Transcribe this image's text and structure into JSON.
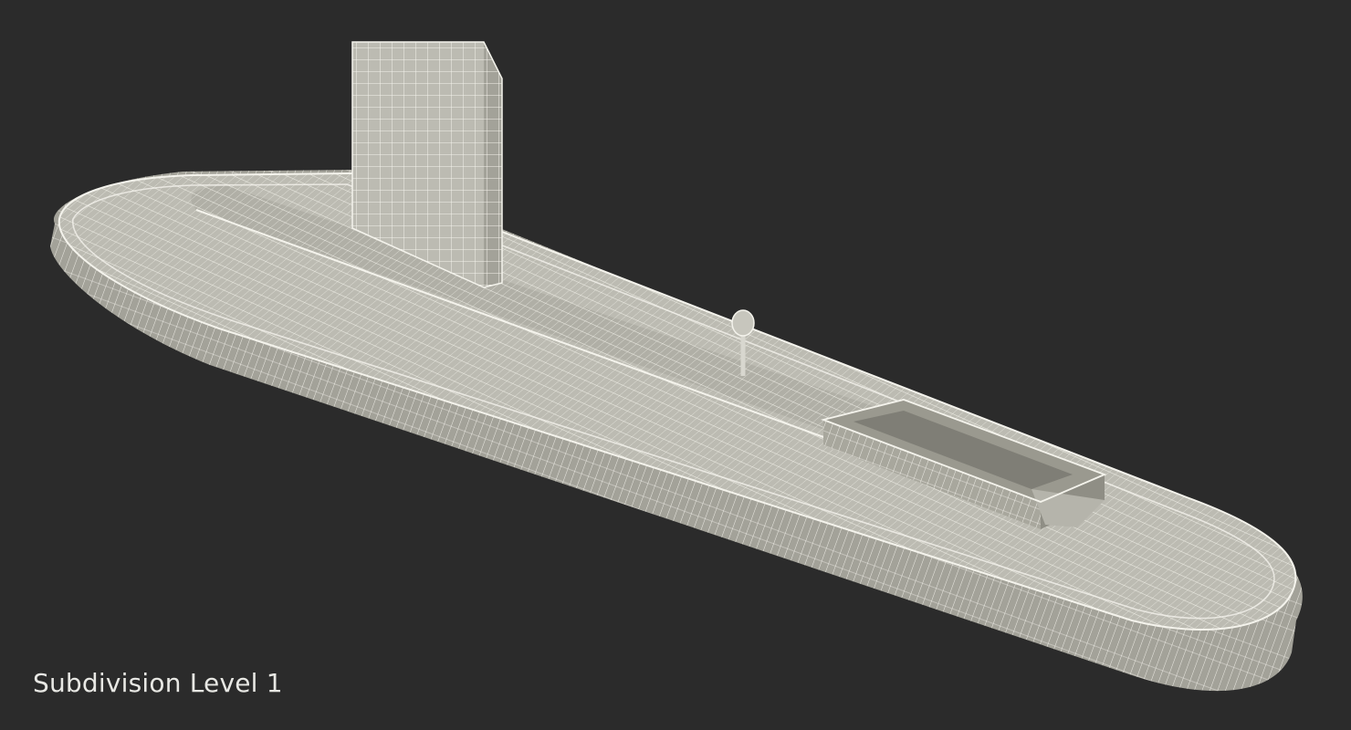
{
  "caption": "Subdivision Level 1",
  "colors": {
    "background": "#2b2b2b",
    "surface": "#bcbbb2",
    "surface_dark": "#a3a299",
    "wire": "#f4f3ec"
  }
}
